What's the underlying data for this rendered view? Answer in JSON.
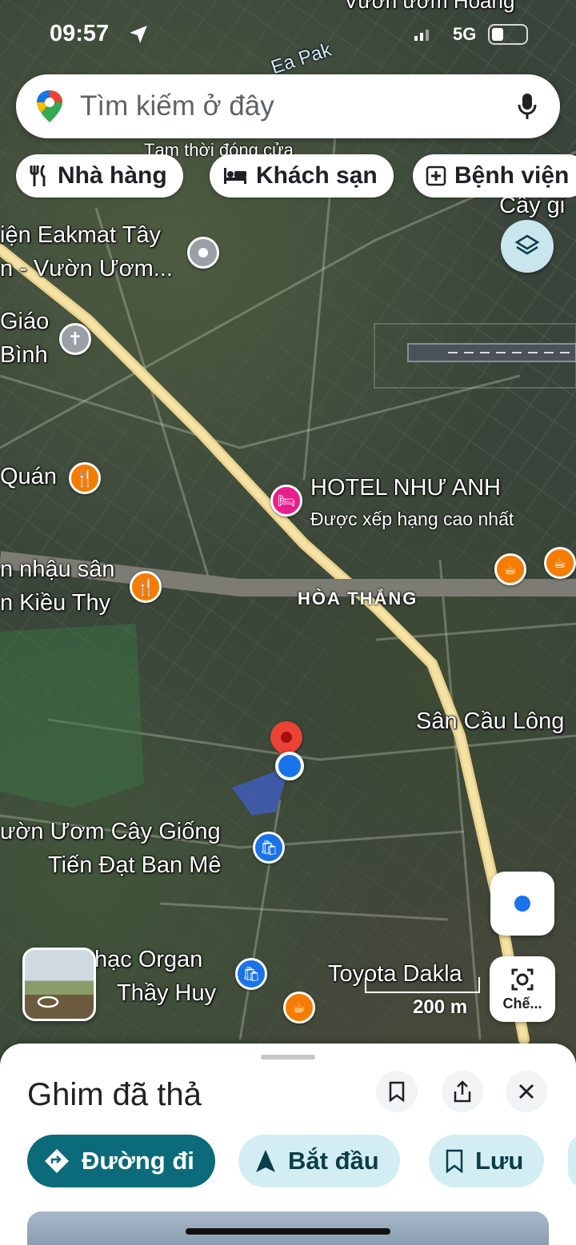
{
  "status_bar": {
    "time": "09:57",
    "network": "5G"
  },
  "search": {
    "placeholder": "Tìm kiếm ở đây"
  },
  "chips": [
    {
      "label": "Nhà hàng",
      "icon": "restaurant-icon"
    },
    {
      "label": "Khách sạn",
      "icon": "hotel-icon"
    },
    {
      "label": "Bệnh viện",
      "icon": "hospital-icon"
    }
  ],
  "map_labels": {
    "top_label": "Vườn ươm Hoàng",
    "river": "Ea Pak",
    "temp_closed": "Tạm thời đóng cửa",
    "cay_gi": "Cây gi",
    "eakmat_1": "iện Eakmat Tây",
    "eakmat_2": "n - Vườn Ươm...",
    "giao_1": "Giáo",
    "giao_2": "Bình",
    "quan": "Quán",
    "hotel_name": "HOTEL NHƯ ANH",
    "hotel_sub": "Được xếp hạng cao nhất",
    "nhau_1": "n nhậu sân",
    "nhau_2": "n Kiều Thy",
    "district": "HÒA THẮNG",
    "badminton": "Sân Cầu Lông",
    "nursery_1": "ườn Ươm Cây Giống",
    "nursery_2": "Tiến Đạt Ban Mê",
    "organ_1": "hạc Organ",
    "organ_2": "Thầy Huy",
    "toyota": "Toyota Dakla",
    "scale": "200 m"
  },
  "buttons": {
    "lens_label": "Chế...",
    "layers": "layers-icon",
    "my_location": "my-location-icon"
  },
  "sheet": {
    "title": "Ghim đã thả",
    "directions": "Đường đi",
    "start": "Bắt đầu",
    "save": "Lưu"
  },
  "colors": {
    "primary": "#0b6b7a",
    "tonal": "#d3eef3",
    "pin_red": "#ea4335",
    "location_blue": "#1a73e8",
    "road_yellow": "#f0d592"
  }
}
